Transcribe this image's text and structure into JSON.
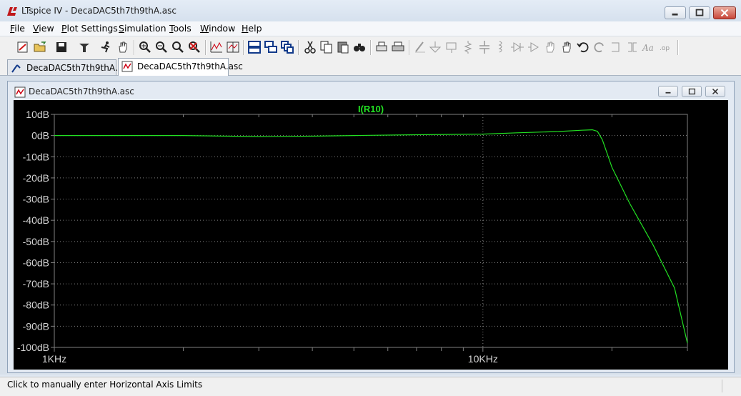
{
  "window": {
    "title": "LTspice IV - DecaDAC5th7th9thA.asc",
    "buttons": [
      "minimize",
      "maximize",
      "close"
    ]
  },
  "menu": [
    {
      "label": "File",
      "u": "F",
      "rest": "ile"
    },
    {
      "label": "View",
      "u": "V",
      "rest": "iew"
    },
    {
      "label": "Plot Settings",
      "u": "P",
      "rest": "lot Settings"
    },
    {
      "label": "Simulation",
      "u": "S",
      "rest": "imulation"
    },
    {
      "label": "Tools",
      "u": "T",
      "rest": "ools"
    },
    {
      "label": "Window",
      "u": "W",
      "rest": "indow"
    },
    {
      "label": "Help",
      "u": "H",
      "rest": "elp"
    }
  ],
  "toolbar_icons": [
    "new-schematic-icon",
    "open-icon",
    "save-icon",
    "control-panel-icon",
    "run-icon",
    "pan-icon",
    "zoom-in-icon",
    "zoom-out-icon",
    "zoom-fit-icon",
    "zoom-cancel-icon",
    "autorange-icon",
    "mark-icon",
    "tile-horizontal-icon",
    "cascade-icon",
    "tile-vertical-icon",
    "cut-icon",
    "copy-icon",
    "paste-icon",
    "find-icon",
    "print-preview-icon",
    "print-icon",
    "wire-icon",
    "ground-icon",
    "label-icon",
    "resistor-icon",
    "capacitor-icon",
    "inductor-icon",
    "diode-icon",
    "component-icon",
    "move-icon",
    "drag-icon",
    "undo-icon",
    "redo-icon",
    "rotate-icon",
    "mirror-icon",
    "text-icon",
    "spice-directive-icon"
  ],
  "tabs": [
    {
      "label": "DecaDAC5th7th9thA.asc",
      "icon": "schematic-icon",
      "active": false
    },
    {
      "label": "DecaDAC5th7th9thA.asc",
      "icon": "waveform-icon",
      "active": true
    }
  ],
  "plot_window": {
    "title": "DecaDAC5th7th9thA.asc"
  },
  "chart_data": {
    "type": "line",
    "title": "",
    "xlabel": "",
    "ylabel": "",
    "x_scale": "log",
    "xlim": [
      1000,
      30000
    ],
    "ylim": [
      -100,
      10
    ],
    "x_ticks": [
      {
        "value": 1000,
        "label": "1KHz"
      },
      {
        "value": 10000,
        "label": "10KHz"
      }
    ],
    "y_ticks": [
      {
        "value": 10,
        "label": "10dB"
      },
      {
        "value": 0,
        "label": "0dB"
      },
      {
        "value": -10,
        "label": "-10dB"
      },
      {
        "value": -20,
        "label": "-20dB"
      },
      {
        "value": -30,
        "label": "-30dB"
      },
      {
        "value": -40,
        "label": "-40dB"
      },
      {
        "value": -50,
        "label": "-50dB"
      },
      {
        "value": -60,
        "label": "-60dB"
      },
      {
        "value": -70,
        "label": "-70dB"
      },
      {
        "value": -80,
        "label": "-80dB"
      },
      {
        "value": -90,
        "label": "-90dB"
      },
      {
        "value": -100,
        "label": "-100dB"
      }
    ],
    "background": "#000000",
    "grid_color": "#7f7f7f",
    "axis_label_color": "#d4d4d4",
    "series": [
      {
        "name": "I(R10)",
        "color": "#22e022",
        "x": [
          1000,
          2000,
          3000,
          4000,
          5000,
          7000,
          10000,
          12000,
          15000,
          17000,
          18000,
          18500,
          19000,
          20000,
          22000,
          25000,
          28000,
          30000
        ],
        "y": [
          0.0,
          0.0,
          -0.5,
          -0.3,
          0.0,
          0.4,
          0.7,
          1.3,
          1.9,
          2.5,
          2.7,
          2.0,
          -2.0,
          -15.0,
          -32.0,
          -52.0,
          -72.0,
          -98.0
        ]
      }
    ]
  },
  "status": {
    "text": "Click to manually enter Horizontal Axis Limits"
  }
}
